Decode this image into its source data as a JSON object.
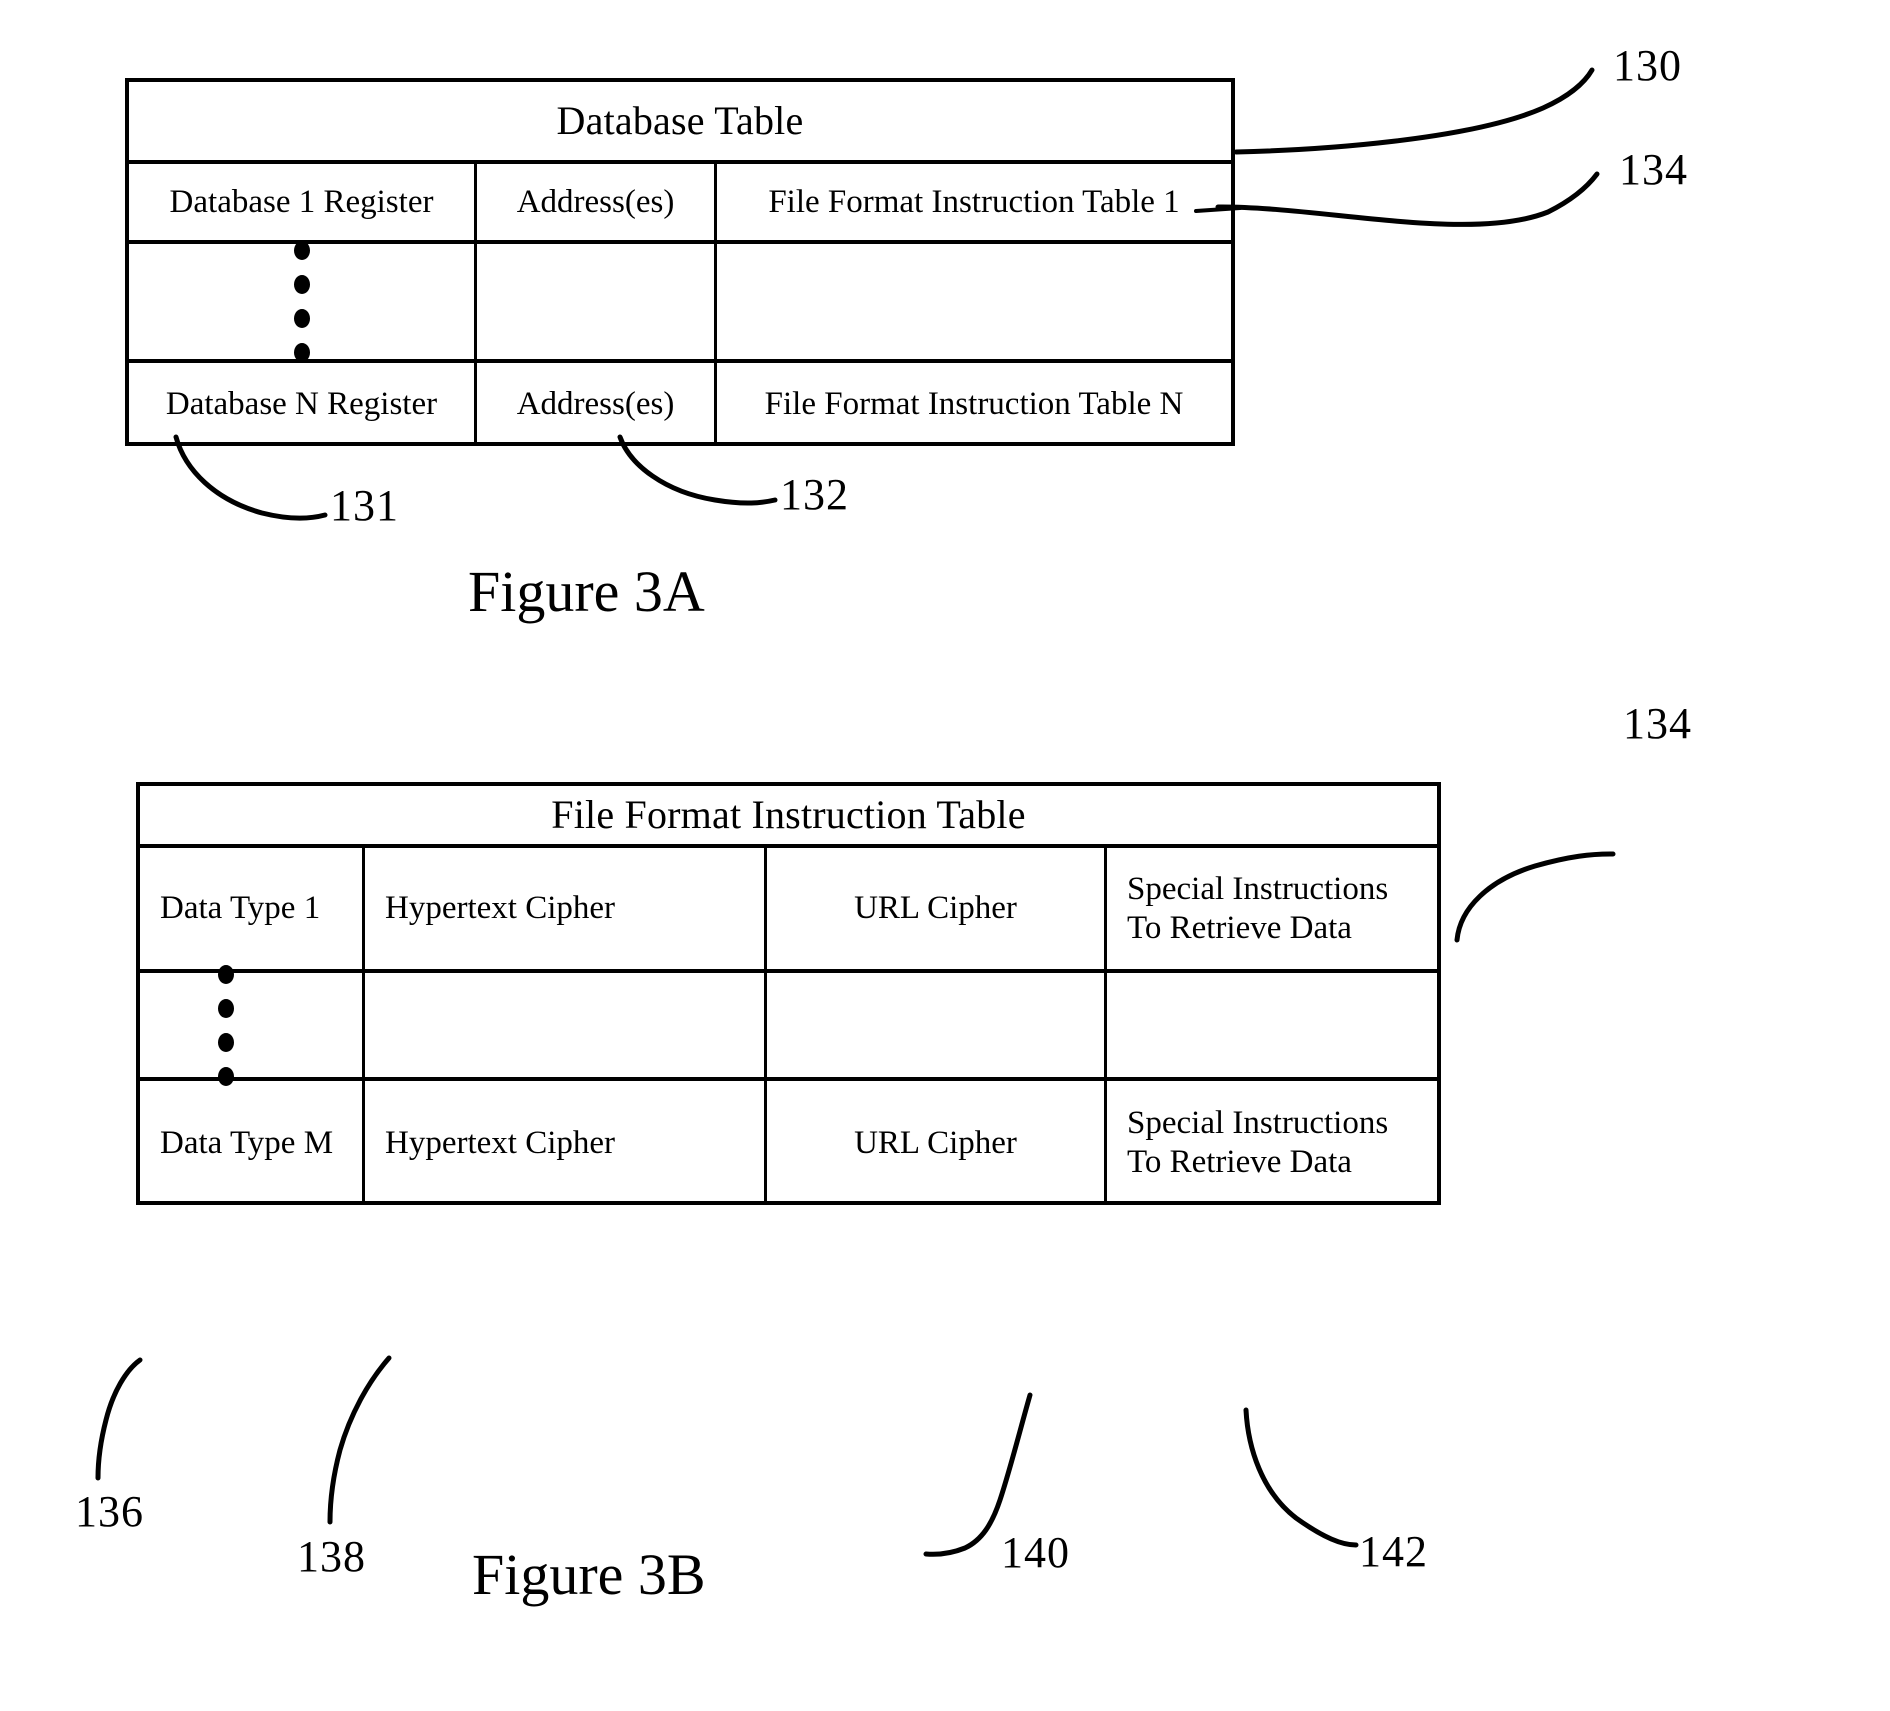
{
  "document": {
    "type": "patent-figure-sheet",
    "figures": [
      {
        "id": "figure-3a",
        "caption": "Figure 3A",
        "table": {
          "title": "Database Table",
          "columns": 3,
          "rows": [
            {
              "kind": "data",
              "cells": [
                "Database 1 Register",
                "Address(es)",
                "File Format Instruction Table 1"
              ]
            },
            {
              "kind": "ellipsis",
              "cells": [
                "",
                "",
                ""
              ],
              "dots": 4
            },
            {
              "kind": "data",
              "cells": [
                "Database N Register",
                "Address(es)",
                "File Format Instruction Table N"
              ]
            }
          ]
        },
        "reference_numerals": [
          {
            "label": "130",
            "points_to": "Database Table outer frame"
          },
          {
            "label": "134",
            "points_to": "File Format Instruction Table 1 cell"
          },
          {
            "label": "131",
            "points_to": "Database N Register cell"
          },
          {
            "label": "132",
            "points_to": "Address(es) cell"
          }
        ]
      },
      {
        "id": "figure-3b",
        "caption": "Figure 3B",
        "table": {
          "title": "File Format Instruction Table",
          "columns": 4,
          "rows": [
            {
              "kind": "data",
              "cells": [
                "Data Type 1",
                "Hypertext Cipher",
                "URL Cipher",
                "Special Instructions\nTo Retrieve Data"
              ]
            },
            {
              "kind": "ellipsis",
              "cells": [
                "",
                "",
                "",
                ""
              ],
              "dots": 4
            },
            {
              "kind": "data",
              "cells": [
                "Data Type M",
                "Hypertext Cipher",
                "URL Cipher",
                "Special Instructions\nTo Retrieve Data"
              ]
            }
          ]
        },
        "reference_numerals": [
          {
            "label": "134",
            "points_to": "File Format Instruction Table outer frame"
          },
          {
            "label": "136",
            "points_to": "Data Type M cell"
          },
          {
            "label": "138",
            "points_to": "Hypertext Cipher cell"
          },
          {
            "label": "140",
            "points_to": "URL Cipher cell"
          },
          {
            "label": "142",
            "points_to": "Special Instructions To Retrieve Data cell"
          }
        ]
      }
    ]
  },
  "fig3a": {
    "caption": "Figure 3A",
    "title": "Database Table",
    "row1": {
      "c1": "Database 1 Register",
      "c2": "Address(es)",
      "c3": "File Format Instruction Table 1"
    },
    "row3": {
      "c1": "Database N Register",
      "c2": "Address(es)",
      "c3": "File Format Instruction Table N"
    },
    "refs": {
      "r130": "130",
      "r134": "134",
      "r131": "131",
      "r132": "132"
    }
  },
  "fig3b": {
    "caption": "Figure 3B",
    "title": "File Format Instruction Table",
    "row1": {
      "c1": "Data Type 1",
      "c2": "Hypertext Cipher",
      "c3": "URL Cipher",
      "c4_line1": "Special Instructions",
      "c4_line2": "To Retrieve Data"
    },
    "row3": {
      "c1": "Data Type M",
      "c2": "Hypertext Cipher",
      "c3": "URL Cipher",
      "c4_line1": "Special Instructions",
      "c4_line2": "To Retrieve Data"
    },
    "refs": {
      "r134": "134",
      "r136": "136",
      "r138": "138",
      "r140": "140",
      "r142": "142"
    }
  },
  "colors": {
    "ink": "#000000",
    "paper": "#ffffff"
  }
}
